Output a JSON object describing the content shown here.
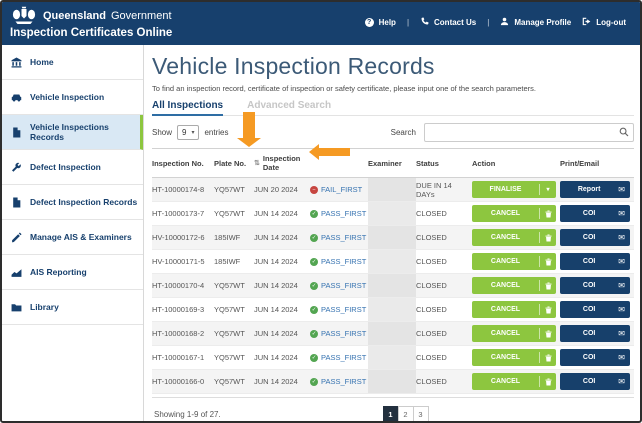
{
  "header": {
    "brand_bold": "Queensland",
    "brand_regular": "Government",
    "app_title": "Inspection Certificates Online",
    "nav": [
      {
        "icon": "help-icon",
        "label": "Help"
      },
      {
        "icon": "phone-icon",
        "label": "Contact Us"
      },
      {
        "icon": "person-icon",
        "label": "Manage Profile"
      },
      {
        "icon": "logout-icon",
        "label": "Log-out"
      }
    ]
  },
  "sidebar": {
    "items": [
      {
        "icon": "home-icon",
        "label": "Home",
        "active": false
      },
      {
        "icon": "car-icon",
        "label": "Vehicle Inspection",
        "active": false
      },
      {
        "icon": "document-icon",
        "label": "Vehicle Inspections Records",
        "active": true
      },
      {
        "icon": "wrench-icon",
        "label": "Defect Inspection",
        "active": false
      },
      {
        "icon": "document-icon",
        "label": "Defect Inspection Records",
        "active": false
      },
      {
        "icon": "pencil-icon",
        "label": "Manage AIS & Examiners",
        "active": false
      },
      {
        "icon": "chart-icon",
        "label": "AIS Reporting",
        "active": false
      },
      {
        "icon": "folder-icon",
        "label": "Library",
        "active": false
      }
    ]
  },
  "main": {
    "title": "Vehicle Inspection Records",
    "description": "To find an inspection record, certificate of inspection or safety certificate, please input one of the search parameters.",
    "tabs": [
      {
        "label": "All Inspections",
        "active": true
      },
      {
        "label": "Advanced Search",
        "active": false
      }
    ],
    "controls": {
      "show_label": "Show",
      "entries_value": "9",
      "entries_suffix": "entries",
      "search_label": "Search",
      "search_value": ""
    },
    "table": {
      "columns": [
        "Inspection No.",
        "Plate No.",
        "Inspection Date",
        "",
        "Examiner",
        "Status",
        "Action",
        "Print/Email"
      ],
      "sorted_column": "Inspection Date",
      "rows": [
        {
          "inspection_no": "HT-10000174-8",
          "plate_no": "YQ57WT",
          "inspection_date": "JUN 20 2024",
          "result": "FAIL_FIRST",
          "result_kind": "fail",
          "examiner": "",
          "status": "DUE IN 14 DAYs",
          "action_label": "FINALISE",
          "action_kind": "finalise",
          "print_label": "Report"
        },
        {
          "inspection_no": "HT-10000173-7",
          "plate_no": "YQ57WT",
          "inspection_date": "JUN 14 2024",
          "result": "PASS_FIRST",
          "result_kind": "pass",
          "examiner": "",
          "status": "CLOSED",
          "action_label": "CANCEL",
          "action_kind": "cancel",
          "print_label": "COI"
        },
        {
          "inspection_no": "HV-10000172-6",
          "plate_no": "185IWF",
          "inspection_date": "JUN 14 2024",
          "result": "PASS_FIRST",
          "result_kind": "pass",
          "examiner": "",
          "status": "CLOSED",
          "action_label": "CANCEL",
          "action_kind": "cancel",
          "print_label": "COI"
        },
        {
          "inspection_no": "HV-10000171-5",
          "plate_no": "185IWF",
          "inspection_date": "JUN 14 2024",
          "result": "PASS_FIRST",
          "result_kind": "pass",
          "examiner": "",
          "status": "CLOSED",
          "action_label": "CANCEL",
          "action_kind": "cancel",
          "print_label": "COI"
        },
        {
          "inspection_no": "HT-10000170-4",
          "plate_no": "YQ57WT",
          "inspection_date": "JUN 14 2024",
          "result": "PASS_FIRST",
          "result_kind": "pass",
          "examiner": "",
          "status": "CLOSED",
          "action_label": "CANCEL",
          "action_kind": "cancel",
          "print_label": "COI"
        },
        {
          "inspection_no": "HT-10000169-3",
          "plate_no": "YQ57WT",
          "inspection_date": "JUN 14 2024",
          "result": "PASS_FIRST",
          "result_kind": "pass",
          "examiner": "",
          "status": "CLOSED",
          "action_label": "CANCEL",
          "action_kind": "cancel",
          "print_label": "COI"
        },
        {
          "inspection_no": "HT-10000168-2",
          "plate_no": "YQ57WT",
          "inspection_date": "JUN 14 2024",
          "result": "PASS_FIRST",
          "result_kind": "pass",
          "examiner": "",
          "status": "CLOSED",
          "action_label": "CANCEL",
          "action_kind": "cancel",
          "print_label": "COI"
        },
        {
          "inspection_no": "HT-10000167-1",
          "plate_no": "YQ57WT",
          "inspection_date": "JUN 14 2024",
          "result": "PASS_FIRST",
          "result_kind": "pass",
          "examiner": "",
          "status": "CLOSED",
          "action_label": "CANCEL",
          "action_kind": "cancel",
          "print_label": "COI"
        },
        {
          "inspection_no": "HT-10000166-0",
          "plate_no": "YQ57WT",
          "inspection_date": "JUN 14 2024",
          "result": "PASS_FIRST",
          "result_kind": "pass",
          "examiner": "",
          "status": "CLOSED",
          "action_label": "CANCEL",
          "action_kind": "cancel",
          "print_label": "COI"
        }
      ]
    },
    "footer": {
      "summary": "Showing 1-9 of 27.",
      "pages": [
        "1",
        "2",
        "3"
      ],
      "active_page": "1"
    }
  },
  "annotations": {
    "arrow_color": "#f59a23",
    "arrows": [
      "down-arrow-pointing-to-inspection-date-column",
      "left-arrow-pointing-to-inspection-date-header"
    ]
  },
  "colors": {
    "header_navy": "#17406d",
    "accent_green": "#8dc63f",
    "button_navy": "#17406b",
    "active_item_bg": "#d9e8f4",
    "link_blue": "#3572b0",
    "fail_red": "#c64540",
    "pass_green": "#53a551",
    "annotation_orange": "#f59a23",
    "pagination_active": "#22303e"
  }
}
